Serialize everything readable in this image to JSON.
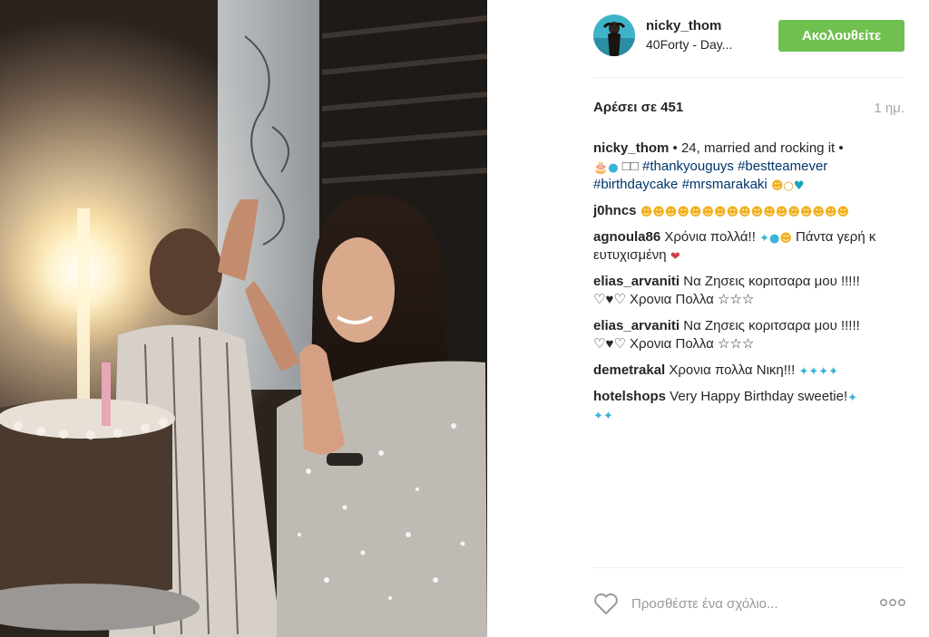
{
  "header": {
    "username": "nicky_thom",
    "location": "40Forty - Day...",
    "follow_label": "Ακολουθείτε"
  },
  "post": {
    "likes": "Αρέσει σε 451",
    "time": "1 ημ."
  },
  "caption": {
    "user": "nicky_thom",
    "text_1": " • 24, married and rocking it • ",
    "box_glyphs": "□□",
    "hashtags": [
      "#thankyouguys",
      "#bestteamever",
      "#birthdaycake",
      "#mrsmarakaki"
    ]
  },
  "comments": [
    {
      "user": "j0hncs",
      "smileys": "😊😊😊😊😊😊😊😊😊😊😊😊😊😊😊😊😊"
    },
    {
      "user": "agnoula86",
      "text": " Χρόνια πολλά!!",
      "text_2": " Πάντα γερή κ ευτυχισμένη"
    },
    {
      "user": "elias_arvaniti",
      "text": " Να Ζησεις κοριτσαρα μου !!!!! ",
      "line_2": "♡♥♡ Χρονια Πολλα ☆☆☆"
    },
    {
      "user": "elias_arvaniti",
      "text": " Να Ζησεις κοριτσαρα μου !!!!! ",
      "line_2": "♡♥♡ Χρονια Πολλα ☆☆☆"
    },
    {
      "user": "demetrakal",
      "text": " Χρονια πολλα Νικη!!!"
    },
    {
      "user": "hotelshops",
      "text": " Very Happy Birthday sweetie!"
    }
  ],
  "add_comment": {
    "placeholder": "Προσθέστε ένα σχόλιο..."
  },
  "icons": {
    "like": "heart-outline-icon",
    "more": "more-options-icon",
    "avatar": "avatar"
  },
  "colors": {
    "follow_button": "#70c050",
    "hashtag": "#003569",
    "timestamp": "#a5a7aa"
  }
}
